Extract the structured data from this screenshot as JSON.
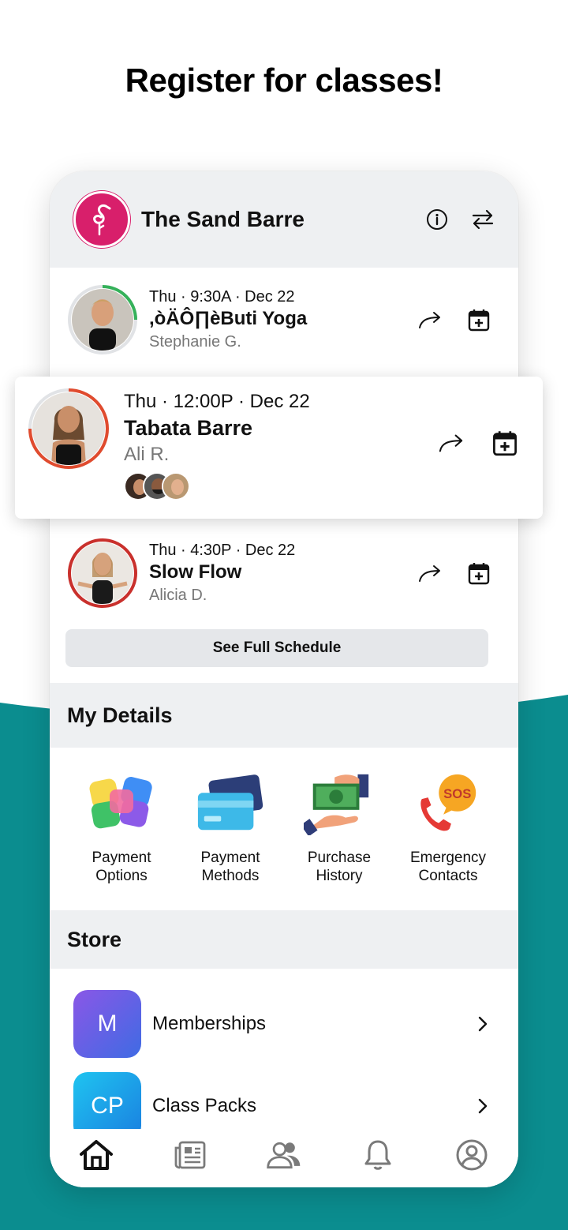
{
  "headline": "Register for classes!",
  "colors": {
    "teal": "#0b8d8f",
    "brand_pink": "#d81f6b",
    "membership": "#6a5ae0",
    "classpack": "#1aa7ec"
  },
  "header": {
    "studio_name": "The Sand Barre",
    "icons": [
      "info-icon",
      "switch-icon"
    ]
  },
  "classes": [
    {
      "time": "Thu · 9:30A · Dec 22",
      "name": ",òÄÔ∏èButi Yoga",
      "instructor": "Stephanie G.",
      "ring": "#35b15a"
    },
    {
      "time": "Thu · 12:00P · Dec 22",
      "name": "Tabata Barre",
      "instructor": "Ali  R.",
      "ring": "#e04b2e"
    },
    {
      "time": "Thu · 4:30P · Dec 22",
      "name": "Slow Flow",
      "instructor": "Alicia D.",
      "ring": "#c9302c"
    }
  ],
  "schedule_button": "See Full Schedule",
  "my_details": {
    "title": "My Details",
    "items": [
      {
        "label": "Payment\nOptions",
        "icon": "payment-options-icon"
      },
      {
        "label": "Payment\nMethods",
        "icon": "credit-card-icon"
      },
      {
        "label": "Purchase\nHistory",
        "icon": "cash-hand-icon"
      },
      {
        "label": "Emergency\nContacts",
        "icon": "sos-phone-icon"
      }
    ]
  },
  "store": {
    "title": "Store",
    "items": [
      {
        "badge": "M",
        "label": "Memberships"
      },
      {
        "badge": "CP",
        "label": "Class Packs"
      }
    ]
  },
  "tabs": [
    "home-icon",
    "news-icon",
    "people-icon",
    "bell-icon",
    "profile-icon"
  ]
}
